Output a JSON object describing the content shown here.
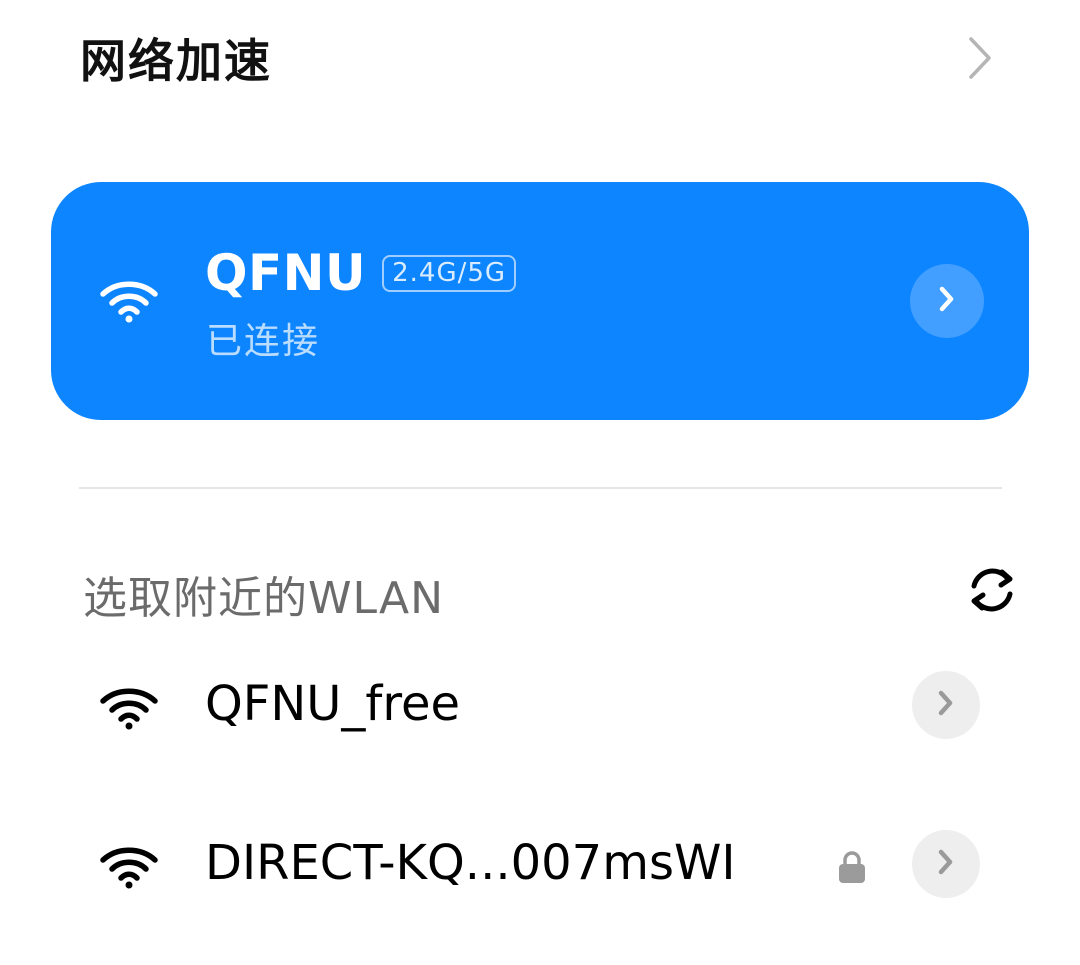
{
  "speed": {
    "label": "网络加速"
  },
  "connected": {
    "ssid": "QFNU",
    "band": "2.4G/5G",
    "status": "已连接",
    "card_color": "#0d85ff"
  },
  "nearby": {
    "title": "选取附近的WLAN",
    "networks": [
      {
        "name": "QFNU_free",
        "secured": false
      },
      {
        "name": "DIRECT-KQ...007msWI",
        "secured": true
      }
    ]
  },
  "icons": {
    "speed_chevron": "chevron-right-icon",
    "card_wifi": "wifi-icon",
    "refresh": "refresh-icon",
    "lock": "lock-icon"
  }
}
